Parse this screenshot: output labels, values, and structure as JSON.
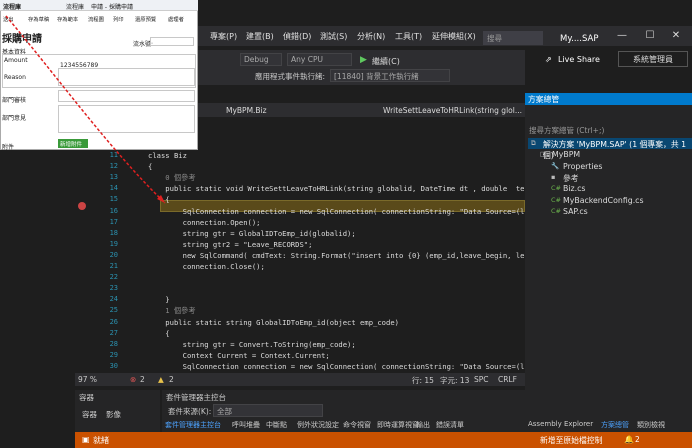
{
  "vs": {
    "menus": [
      "專案(P)",
      "建置(B)",
      "偵錯(D)",
      "測試(S)",
      "分析(N)",
      "工具(T)",
      "延伸模組(X)"
    ],
    "search_placeholder": "搜尋",
    "window_title": "My....SAP",
    "live_share": "Live Share",
    "admin": "系統管理員",
    "debug_config": "Debug",
    "platform": "Any CPU",
    "start_label": "繼續(C)",
    "app_event_label": "應用程式事件",
    "thread_label": "執行緒:",
    "thread_value": "[11840] 背景工作執行緒"
  },
  "editor": {
    "tab_file": "MyBPM.Biz",
    "method_nav": "WriteSettLeaveToHRLink(string glol...",
    "line_numbers": [
      "11",
      "12",
      "13",
      "14",
      "15",
      "16",
      "17",
      "18",
      "19",
      "20",
      "21",
      "22",
      "23",
      "24",
      "25",
      "26",
      "27",
      "28",
      "29",
      "30",
      "31"
    ],
    "code_lines": [
      "class Biz",
      "{",
      "    0 個參考",
      "    public static void WriteSettLeaveToHRLink(string globalid, DateTime dt , double  test)",
      "    {",
      "        SqlConnection connection = new SqlConnection( connectionString: \"Data Source=(local) ;I",
      "        connection.Open();",
      "        string gtr = GlobalIDToEmp_id(globalid);",
      "        string gtr2 = \"Leave_RECORDS\";",
      "        new SqlCommand( cmdText: String.Format(\"insert into {0} (emp_id,leave_begin, leave)\"",
      "        connection.Close();",
      "",
      "",
      "    }",
      "    1 個參考",
      "    public static string GlobalIDToEmp_id(object emp_code)",
      "    {",
      "        string gtr = Convert.ToString(emp_code);",
      "        Context Current = Context.Current;",
      "        SqlConnection connection = new SqlConnection( connectionString: \"Data Source=(local) ;I",
      "        connection.Open();"
    ],
    "zoom": "97 %",
    "errors": "2",
    "warnings": "2",
    "line": "行: 15",
    "char": "字元: 13",
    "spc": "SPC",
    "crlf": "CRLF"
  },
  "bottom": {
    "left_title": "容器",
    "left_tabs": [
      "容器",
      "影像"
    ],
    "mid_title": "套件管理器主控台",
    "source_label": "套件來源(K):",
    "source_value": "全部",
    "tabs": [
      "套件管理器主控台",
      "呼叫堆疊",
      "中斷點",
      "例外狀況設定",
      "命令視窗",
      "即時運算視窗",
      "輸出",
      "錯誤清單"
    ]
  },
  "status": {
    "ready": "就緒",
    "source_control": "新增至原始檔控制",
    "notifications": "2"
  },
  "solution": {
    "title": "方案總管",
    "search_placeholder": "搜尋方案總管 (Ctrl+;)",
    "items": [
      "解決方案 'MyBPM.SAP' (1 個專案，共 1 個)",
      "MyBPM",
      "Properties",
      "參考",
      "Biz.cs",
      "MyBackendConfig.cs",
      "SAP.cs"
    ],
    "bottom_tabs": [
      "Assembly Explorer",
      "方案總管",
      "類別檢視"
    ]
  },
  "bpm": {
    "header_title": "流程庫",
    "nav_items": [
      "流程庫",
      "申請 - 採購申請"
    ],
    "toolbar": [
      "送出",
      "存為草稿",
      "存為範本",
      "流程圖",
      "列印",
      "還原預覽",
      "處理者"
    ],
    "form_title": "採購申請",
    "form_no_label": "流水號:",
    "basic_info": "基本資料",
    "reason_label": "Reason",
    "amount_label": "Amount",
    "amount_value": "1234556789",
    "section_approval": "部門審核",
    "section_opinion": "部門意見",
    "attachment_label": "附件",
    "upload_button": "新增附件"
  }
}
